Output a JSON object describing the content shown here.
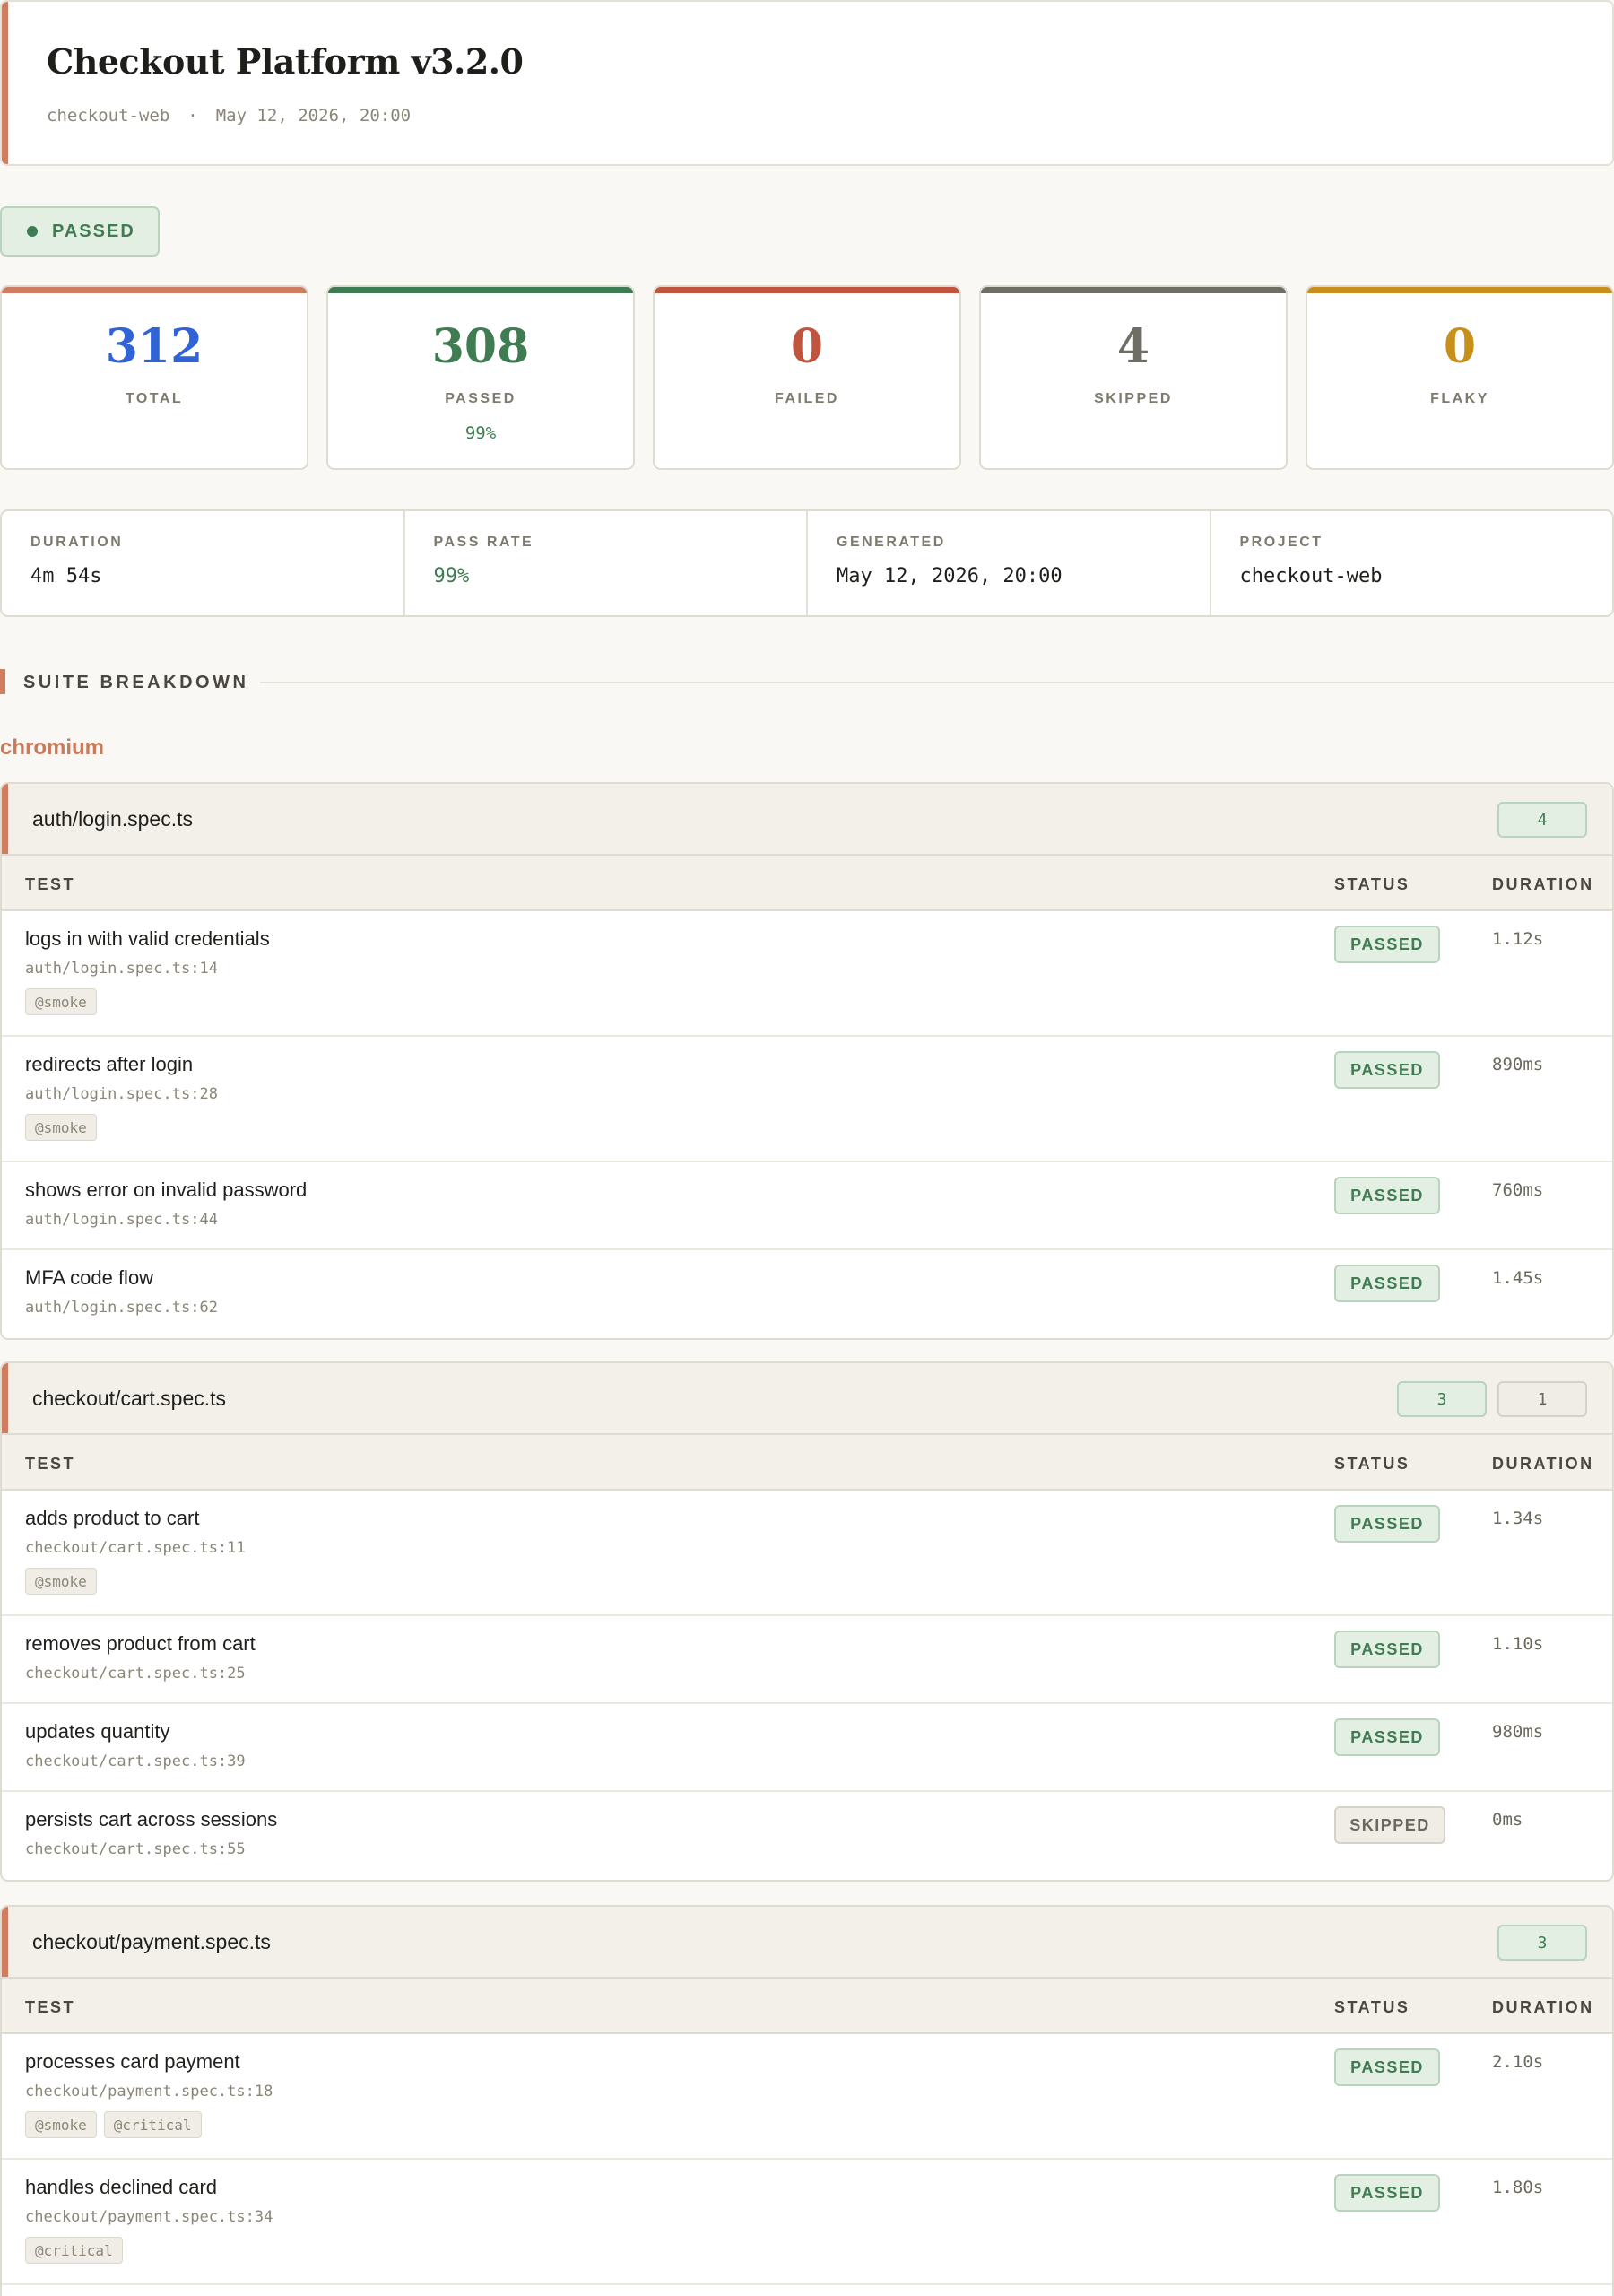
{
  "header": {
    "title": "Checkout Platform v3.2.0",
    "project": "checkout-web",
    "separator": "·",
    "timestamp": "May 12, 2026, 20:00"
  },
  "run_status": {
    "label": "PASSED",
    "color": "#3f7c52"
  },
  "stats": [
    {
      "value": "312",
      "label": "TOTAL",
      "color": "#2f63d6",
      "bar": "#cf7d60"
    },
    {
      "value": "308",
      "label": "PASSED",
      "sub": "99%",
      "color": "#3f7c52",
      "bar": "#3f7c52"
    },
    {
      "value": "0",
      "label": "FAILED",
      "color": "#c0553f",
      "bar": "#c0553f"
    },
    {
      "value": "4",
      "label": "SKIPPED",
      "color": "#6e6d66",
      "bar": "#6e6d66"
    },
    {
      "value": "0",
      "label": "FLAKY",
      "color": "#c8901b",
      "bar": "#c8901b"
    }
  ],
  "info": {
    "duration": {
      "label": "DURATION",
      "value": "4m 54s"
    },
    "pass_rate": {
      "label": "PASS RATE",
      "value": "99%"
    },
    "generated": {
      "label": "GENERATED",
      "value": "May 12, 2026, 20:00"
    },
    "project": {
      "label": "PROJECT",
      "value": "checkout-web"
    }
  },
  "section_title": "SUITE BREAKDOWN",
  "browser": "chromium",
  "table_headers": {
    "test": "TEST",
    "status": "STATUS",
    "duration": "DURATION"
  },
  "suites": [
    {
      "name": "auth/login.spec.ts",
      "counts": {
        "passed": "4"
      },
      "tests": [
        {
          "name": "logs in with valid credentials",
          "location": "auth/login.spec.ts:14",
          "tags": [
            "@smoke"
          ],
          "status": "PASSED",
          "duration": "1.12s"
        },
        {
          "name": "redirects after login",
          "location": "auth/login.spec.ts:28",
          "tags": [
            "@smoke"
          ],
          "status": "PASSED",
          "duration": "890ms"
        },
        {
          "name": "shows error on invalid password",
          "location": "auth/login.spec.ts:44",
          "tags": [],
          "status": "PASSED",
          "duration": "760ms"
        },
        {
          "name": "MFA code flow",
          "location": "auth/login.spec.ts:62",
          "tags": [],
          "status": "PASSED",
          "duration": "1.45s"
        }
      ]
    },
    {
      "name": "checkout/cart.spec.ts",
      "counts": {
        "passed": "3",
        "skipped": "1"
      },
      "tests": [
        {
          "name": "adds product to cart",
          "location": "checkout/cart.spec.ts:11",
          "tags": [
            "@smoke"
          ],
          "status": "PASSED",
          "duration": "1.34s"
        },
        {
          "name": "removes product from cart",
          "location": "checkout/cart.spec.ts:25",
          "tags": [],
          "status": "PASSED",
          "duration": "1.10s"
        },
        {
          "name": "updates quantity",
          "location": "checkout/cart.spec.ts:39",
          "tags": [],
          "status": "PASSED",
          "duration": "980ms"
        },
        {
          "name": "persists cart across sessions",
          "location": "checkout/cart.spec.ts:55",
          "tags": [],
          "status": "SKIPPED",
          "duration": "0ms"
        }
      ]
    },
    {
      "name": "checkout/payment.spec.ts",
      "counts": {
        "passed": "3"
      },
      "tests": [
        {
          "name": "processes card payment",
          "location": "checkout/payment.spec.ts:18",
          "tags": [
            "@smoke",
            "@critical"
          ],
          "status": "PASSED",
          "duration": "2.10s"
        },
        {
          "name": "handles declined card",
          "location": "checkout/payment.spec.ts:34",
          "tags": [
            "@critical"
          ],
          "status": "PASSED",
          "duration": "1.80s"
        }
      ]
    }
  ]
}
